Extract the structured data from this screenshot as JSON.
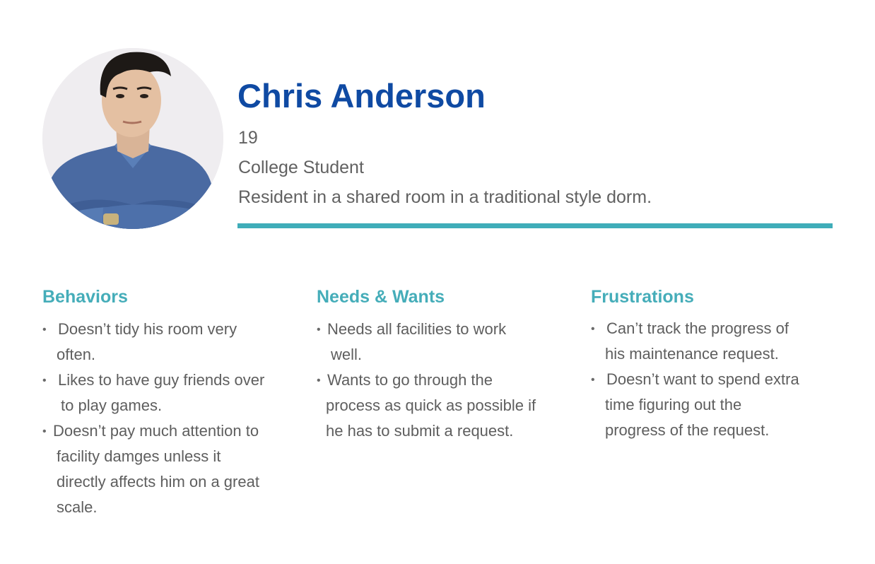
{
  "persona": {
    "name": "Chris Anderson",
    "age": "19",
    "occupation": "College Student",
    "residence": "Resident in a shared room in a traditional style dorm."
  },
  "sections": {
    "behaviors": {
      "title": "Behaviors",
      "lines": [
        "Doesn’t tidy his room very",
        "often.",
        "Likes to have guy friends over",
        "to play games.",
        "Doesn’t pay much attention to",
        "facility damges unless it",
        "directly affects him on a great",
        "scale."
      ]
    },
    "needs": {
      "title": "Needs & Wants",
      "lines": [
        "Needs all facilities to work",
        "well.",
        "Wants to go through the",
        "process as quick as possible if",
        "he has to submit a request."
      ]
    },
    "frustrations": {
      "title": "Frustrations",
      "lines": [
        "Can’t track the progress of",
        "his maintenance request.",
        "Doesn’t want to spend extra",
        "time figuring out the",
        "progress of the request."
      ]
    }
  },
  "bullet_char": "•",
  "colors": {
    "name": "#0f4aa3",
    "accent": "#45adb9",
    "divider": "#3fadb9",
    "body_text": "#5e5e5e"
  }
}
